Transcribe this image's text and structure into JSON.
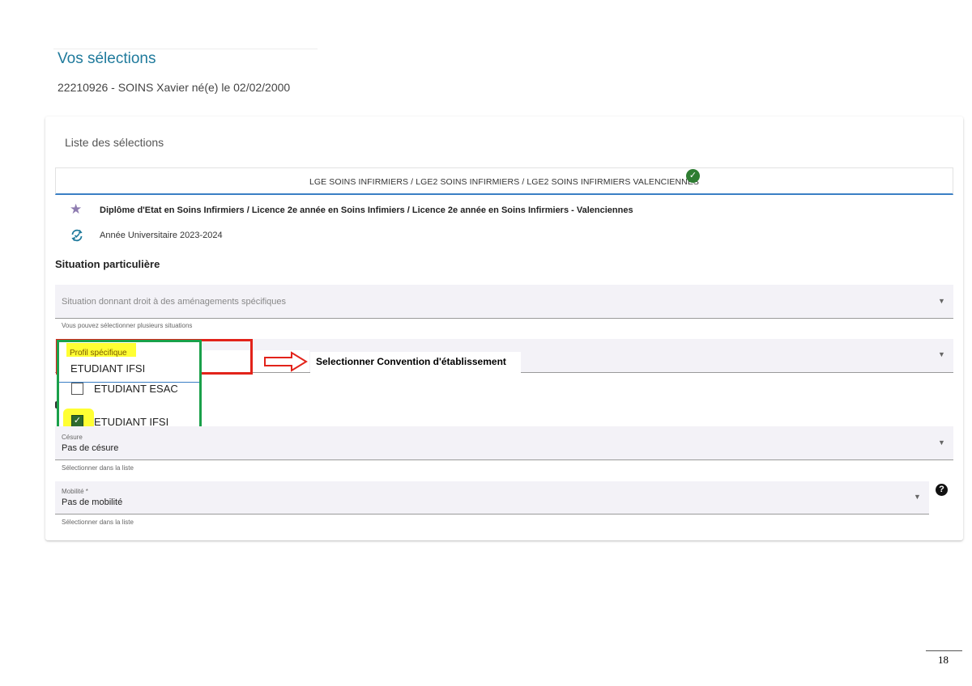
{
  "page": {
    "title": "Vos sélections",
    "student": "22210926 - SOINS Xavier né(e) le 02/02/2000",
    "page_number": "18"
  },
  "card": {
    "title": "Liste des sélections",
    "tab_label": "LGE SOINS INFIRMIERS / LGE2 SOINS INFIRMIERS / LGE2 SOINS INFIRMIERS VALENCIENNES",
    "tab_status": "✓",
    "diploma": "Diplôme d'Etat en Soins Infirmiers / Licence 2e année en Soins Infimiers / Licence 2e année en Soins Infirmiers - Valenciennes",
    "academic_year": "Année Universitaire 2023-2024"
  },
  "situation": {
    "section_title": "Situation particulière",
    "field_placeholder": "Situation donnant droit à des aménagements spécifiques",
    "field_hint": "Vous pouvez sélectionner plusieurs situations"
  },
  "profil": {
    "label": "Profil spécifique",
    "value": "ETUDIANT IFSI",
    "options": [
      {
        "label": "ETUDIANT ESAC",
        "checked": false
      },
      {
        "label": "ETUDIANT IFSI",
        "checked": true
      }
    ],
    "instruction": "Selectionner Convention d'établissement"
  },
  "cesure": {
    "label": "Césure",
    "value": "Pas de césure",
    "hint": "Sélectionner dans la liste"
  },
  "mobilite": {
    "label": "Mobilité *",
    "value": "Pas de mobilité",
    "hint": "Sélectionner dans la liste",
    "help": "?"
  },
  "icons": {
    "caret": "▼",
    "star": "★"
  },
  "colors": {
    "title_blue": "#1f7a9c",
    "highlight_yellow": "#ffff33",
    "annotation_red": "#e2231a",
    "annotation_green": "#1aa04a",
    "check_green": "#2e7d32"
  }
}
